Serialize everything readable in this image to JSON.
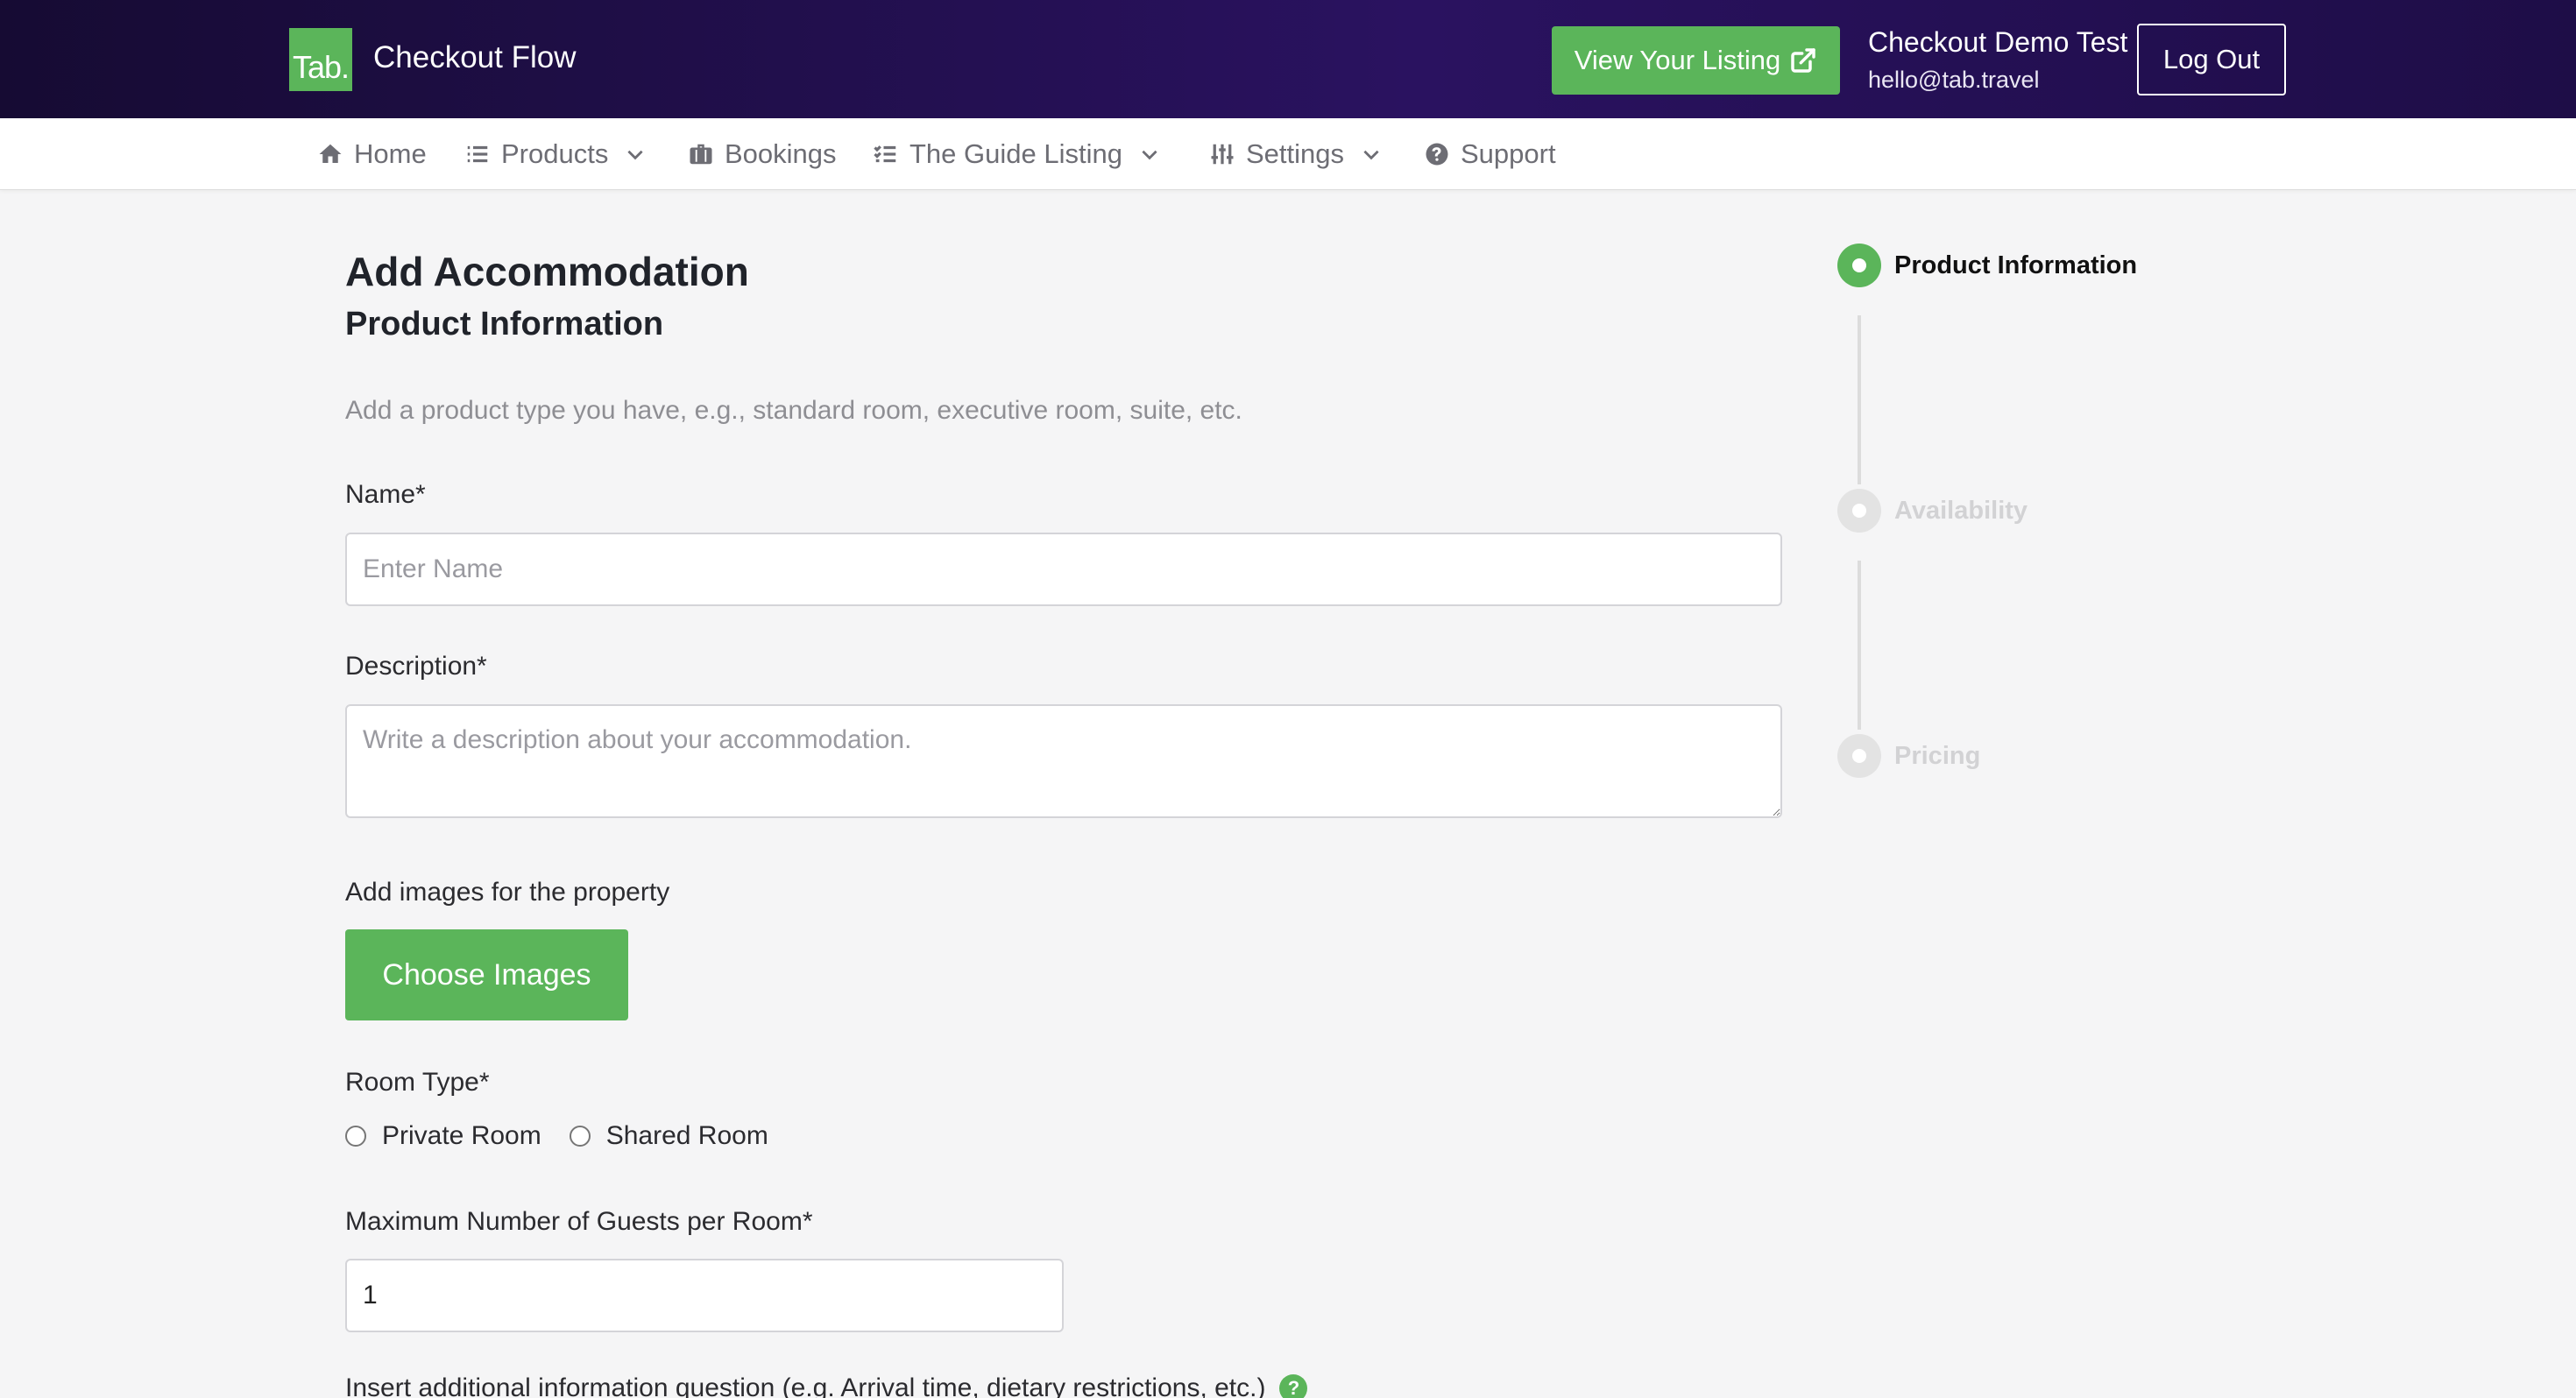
{
  "header": {
    "logo_text": "Tab.",
    "app_title": "Checkout Flow",
    "view_listing_label": "View Your Listing",
    "user_name": "Checkout Demo Test",
    "user_email": "hello@tab.travel",
    "logout_label": "Log Out",
    "colors": {
      "background": "#1e0d47",
      "accent": "#5bb55a"
    }
  },
  "nav": {
    "items": [
      {
        "label": "Home",
        "icon": "home-icon"
      },
      {
        "label": "Products",
        "icon": "list-icon",
        "dropdown": true
      },
      {
        "label": "Bookings",
        "icon": "suitcase-icon"
      },
      {
        "label": "The Guide Listing",
        "icon": "checklist-icon",
        "dropdown": true
      },
      {
        "label": "Settings",
        "icon": "sliders-icon",
        "dropdown": true
      },
      {
        "label": "Support",
        "icon": "question-circle-icon"
      }
    ]
  },
  "form": {
    "page_title": "Add Accommodation",
    "section_title": "Product Information",
    "intro": "Add a product type you have, e.g., standard room, executive room, suite, etc.",
    "name_label": "Name*",
    "name_placeholder": "Enter Name",
    "description_label": "Description*",
    "description_placeholder": "Write a description about your accommodation.",
    "images_label": "Add images for the property",
    "choose_images_label": "Choose Images",
    "room_type_label": "Room Type*",
    "room_type_options": [
      "Private Room",
      "Shared Room"
    ],
    "max_guests_label": "Maximum Number of Guests per Room*",
    "max_guests_value": "1",
    "additional_question_label": "Insert additional information question (e.g. Arrival time, dietary restrictions, etc.)",
    "help_icon_glyph": "?"
  },
  "stepper": {
    "steps": [
      {
        "label": "Product Information",
        "state": "active"
      },
      {
        "label": "Availability",
        "state": "inactive"
      },
      {
        "label": "Pricing",
        "state": "inactive"
      }
    ]
  }
}
